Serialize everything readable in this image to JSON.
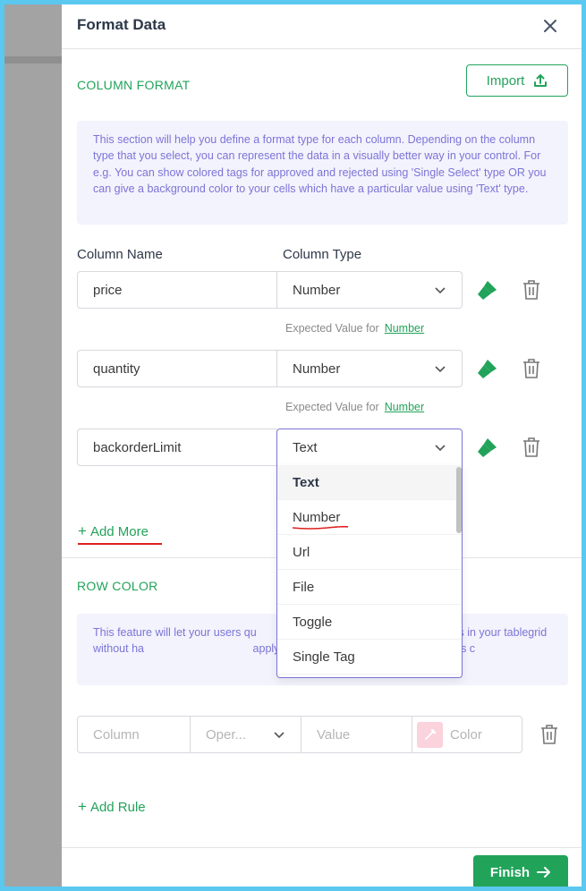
{
  "panel": {
    "title": "Format Data"
  },
  "column_format": {
    "section_title": "COLUMN FORMAT",
    "import_label": "Import",
    "info": "This section will help you define a format type for each column. Depending on the column type that you select, you can represent the data in a visually better way in your control. For e.g. You can show colored tags for approved and rejected using 'Single Select' type OR you can give a background color to your cells which have a particular value using 'Text' type.",
    "column_name_label": "Column Name",
    "column_type_label": "Column Type",
    "rows": [
      {
        "name": "price",
        "type": "Number",
        "expected_prefix": "Expected Value for",
        "expected_link": "Number"
      },
      {
        "name": "quantity",
        "type": "Number",
        "expected_prefix": "Expected Value for",
        "expected_link": "Number"
      },
      {
        "name": "backorderLimit",
        "type": "Text"
      }
    ],
    "add_more_label": "Add More"
  },
  "dropdown": {
    "options": [
      "Text",
      "Number",
      "Url",
      "File",
      "Toggle",
      "Single Tag"
    ],
    "selected": "Text"
  },
  "row_color": {
    "section_title": "ROW COLOR",
    "info": "This feature will let your users qu                                    tions between rows in your tablegrid without ha                                   apply colors using different rules/conditions c",
    "rule": {
      "column_placeholder": "Column",
      "operator_placeholder": "Oper...",
      "value_placeholder": "Value",
      "color_placeholder": "Color"
    },
    "add_rule_label": "Add Rule"
  },
  "footer": {
    "finish_label": "Finish"
  },
  "colors": {
    "accent": "#22a35a",
    "info_text": "#7b74d6",
    "info_bg": "#f3f3fd",
    "highlight_underline": "#e02020"
  }
}
